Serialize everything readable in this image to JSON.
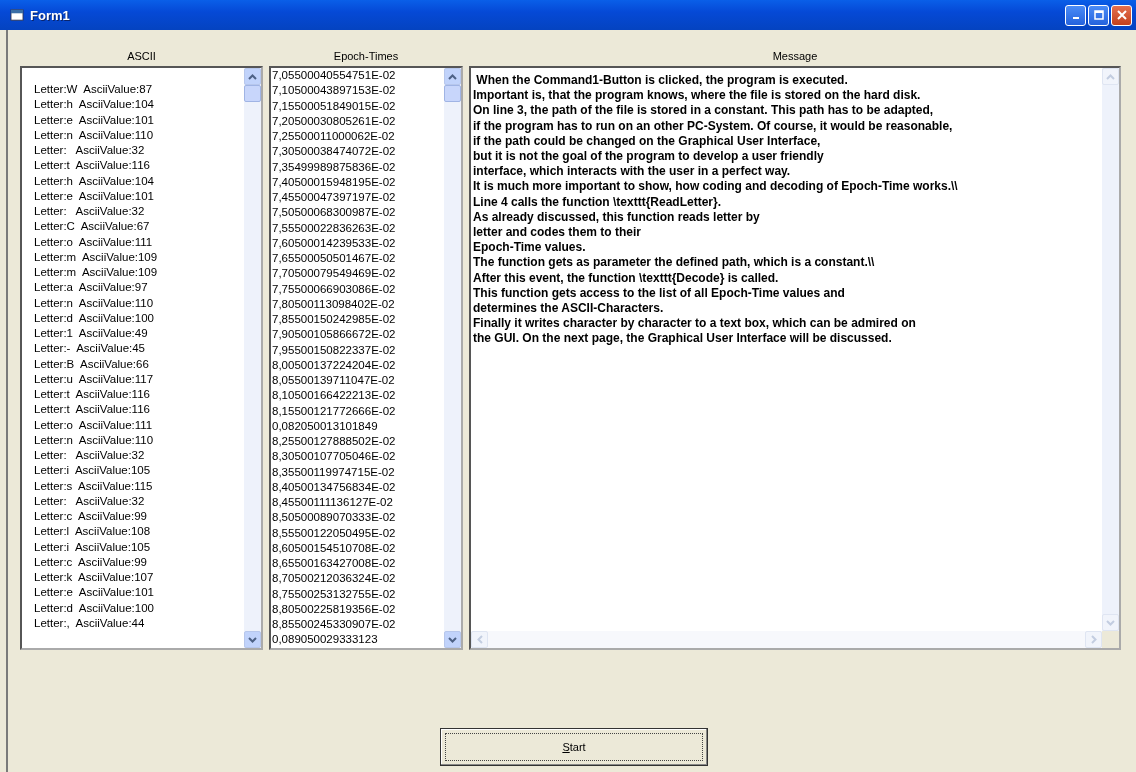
{
  "window": {
    "title": "Form1"
  },
  "ascii_list": {
    "heading": "ASCII",
    "items": [
      "Letter:W  AsciiValue:87",
      "Letter:h  AsciiValue:104",
      "Letter:e  AsciiValue:101",
      "Letter:n  AsciiValue:110",
      "Letter:   AsciiValue:32",
      "Letter:t  AsciiValue:116",
      "Letter:h  AsciiValue:104",
      "Letter:e  AsciiValue:101",
      "Letter:   AsciiValue:32",
      "Letter:C  AsciiValue:67",
      "Letter:o  AsciiValue:111",
      "Letter:m  AsciiValue:109",
      "Letter:m  AsciiValue:109",
      "Letter:a  AsciiValue:97",
      "Letter:n  AsciiValue:110",
      "Letter:d  AsciiValue:100",
      "Letter:1  AsciiValue:49",
      "Letter:-  AsciiValue:45",
      "Letter:B  AsciiValue:66",
      "Letter:u  AsciiValue:117",
      "Letter:t  AsciiValue:116",
      "Letter:t  AsciiValue:116",
      "Letter:o  AsciiValue:111",
      "Letter:n  AsciiValue:110",
      "Letter:   AsciiValue:32",
      "Letter:i  AsciiValue:105",
      "Letter:s  AsciiValue:115",
      "Letter:   AsciiValue:32",
      "Letter:c  AsciiValue:99",
      "Letter:l  AsciiValue:108",
      "Letter:i  AsciiValue:105",
      "Letter:c  AsciiValue:99",
      "Letter:k  AsciiValue:107",
      "Letter:e  AsciiValue:101",
      "Letter:d  AsciiValue:100",
      "Letter:,  AsciiValue:44"
    ]
  },
  "epoch_list": {
    "heading": "Epoch-Times",
    "items": [
      "7,05500040554751E-02",
      "7,10500043897153E-02",
      "7,15500051849015E-02",
      "7,20500030805261E-02",
      "7,25500011000062E-02",
      "7,30500038474072E-02",
      "7,35499989875836E-02",
      "7,40500015948195E-02",
      "7,45500047397197E-02",
      "7,50500068300987E-02",
      "7,55500022836263E-02",
      "7,60500014239533E-02",
      "7,65500050501467E-02",
      "7,70500079549469E-02",
      "7,75500066903086E-02",
      "7,80500113098402E-02",
      "7,85500150242985E-02",
      "7,90500105866672E-02",
      "7,95500150822337E-02",
      "8,00500137224204E-02",
      "8,05500139711047E-02",
      "8,10500166422213E-02",
      "8,15500121772666E-02",
      "0,082050013101849",
      "8,25500127888502E-02",
      "8,30500107705046E-02",
      "8,35500119974715E-02",
      "8,40500134756834E-02",
      "8,45500111136127E-02",
      "8,50500089070333E-02",
      "8,55500122050495E-02",
      "8,60500154510708E-02",
      "8,65500163427008E-02",
      "8,70500212036324E-02",
      "8,75500253132755E-02",
      "8,80500225819356E-02",
      "8,85500245330907E-02",
      "0,089050029333123"
    ]
  },
  "message": {
    "heading": "Message",
    "lines": [
      " When the Command1-Button is clicked, the program is executed.",
      "Important is, that the program knows, where the file is stored on the hard disk.",
      "On line 3, the path of the file is stored in a constant. This path has to be adapted,",
      "if the program has to run on an other PC-System. Of course, it would be reasonable,",
      "if the path could be changed on the Graphical User Interface,",
      "but it is not the goal of the program to develop a user friendly",
      "interface, which interacts with the user in a perfect way.",
      "It is much more important to show, how coding and decoding of Epoch-Time works.\\\\",
      "Line 4 calls the function \\texttt{ReadLetter}.",
      "As already discussed, this function reads letter by",
      "letter and codes them to their",
      "Epoch-Time values.",
      "The function gets as parameter the defined path, which is a constant.\\\\",
      "After this event, the function \\texttt{Decode} is called.",
      "This function gets access to the list of all Epoch-Time values and",
      "determines the ASCII-Characters.",
      "Finally it writes character by character to a text box, which can be admired on",
      "the GUI. On the next page, the Graphical User Interface will be discussed."
    ]
  },
  "start_button": {
    "label": "Start"
  }
}
